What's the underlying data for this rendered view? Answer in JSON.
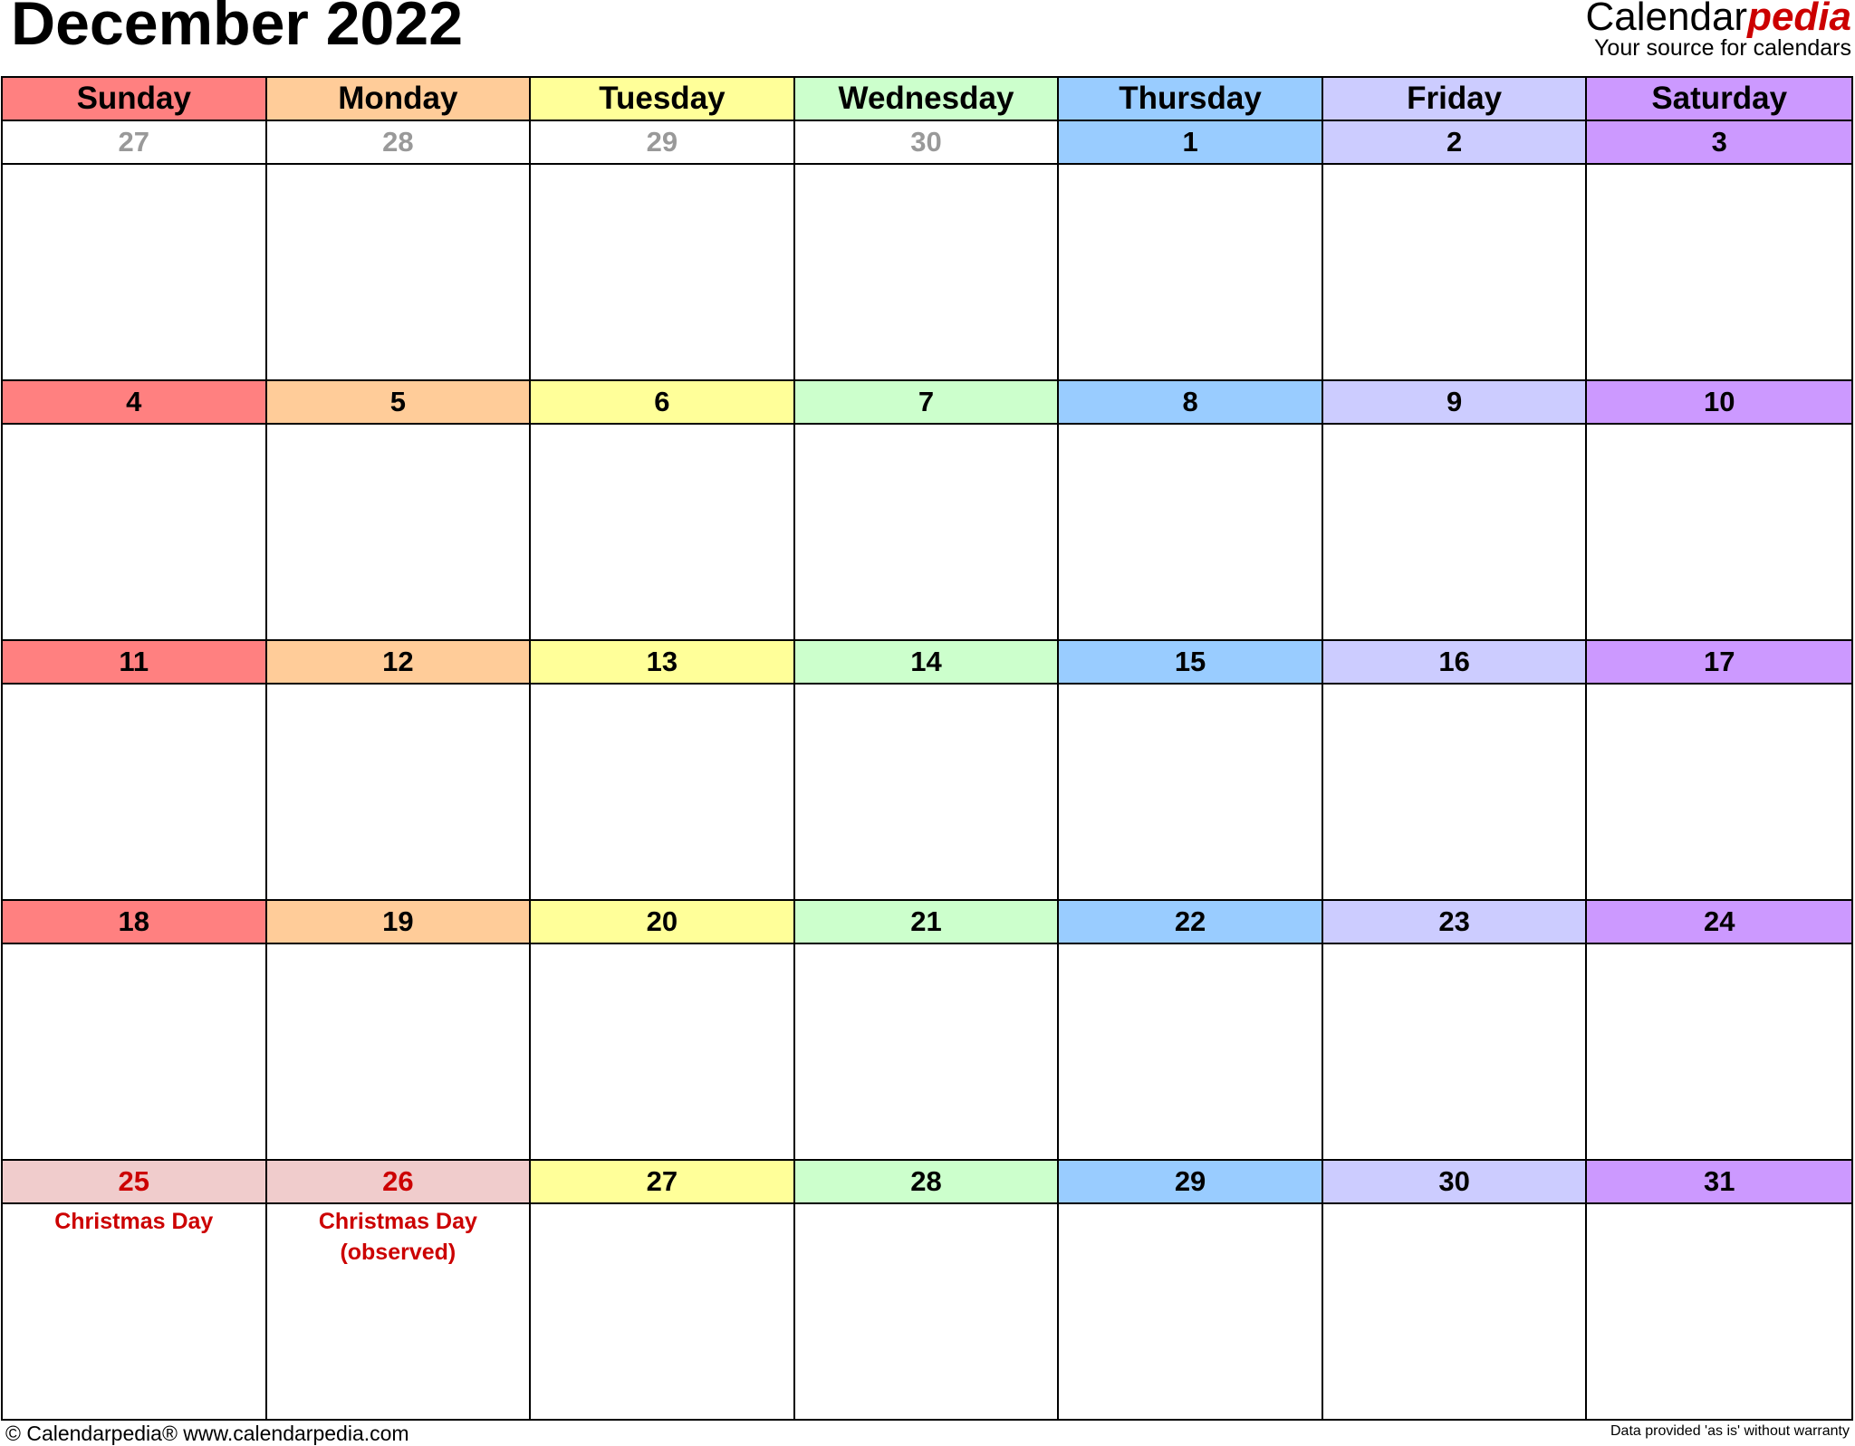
{
  "title": "December 2022",
  "brand": {
    "name_main": "Calendar",
    "name_accent": "pedia",
    "tagline": "Your source for calendars"
  },
  "colors": {
    "days": [
      "#FF8080",
      "#FFCC99",
      "#FFFF99",
      "#CCFFCC",
      "#99CCFF",
      "#CCCCFF",
      "#CC99FF"
    ],
    "holiday": "#F0CCCC",
    "other_month_text": "#999999",
    "holiday_text": "#CC0000"
  },
  "weekdays": [
    "Sunday",
    "Monday",
    "Tuesday",
    "Wednesday",
    "Thursday",
    "Friday",
    "Saturday"
  ],
  "weeks": [
    [
      {
        "d": "27",
        "other": true
      },
      {
        "d": "28",
        "other": true
      },
      {
        "d": "29",
        "other": true
      },
      {
        "d": "30",
        "other": true
      },
      {
        "d": "1"
      },
      {
        "d": "2"
      },
      {
        "d": "3"
      }
    ],
    [
      {
        "d": "4"
      },
      {
        "d": "5"
      },
      {
        "d": "6"
      },
      {
        "d": "7"
      },
      {
        "d": "8"
      },
      {
        "d": "9"
      },
      {
        "d": "10"
      }
    ],
    [
      {
        "d": "11"
      },
      {
        "d": "12"
      },
      {
        "d": "13"
      },
      {
        "d": "14"
      },
      {
        "d": "15"
      },
      {
        "d": "16"
      },
      {
        "d": "17"
      }
    ],
    [
      {
        "d": "18"
      },
      {
        "d": "19"
      },
      {
        "d": "20"
      },
      {
        "d": "21"
      },
      {
        "d": "22"
      },
      {
        "d": "23"
      },
      {
        "d": "24"
      }
    ],
    [
      {
        "d": "25",
        "holiday": "Christmas Day"
      },
      {
        "d": "26",
        "holiday": "Christmas Day (observed)"
      },
      {
        "d": "27"
      },
      {
        "d": "28"
      },
      {
        "d": "29"
      },
      {
        "d": "30"
      },
      {
        "d": "31"
      }
    ]
  ],
  "footer": {
    "left": "© Calendarpedia®   www.calendarpedia.com",
    "right": "Data provided 'as is' without warranty"
  }
}
